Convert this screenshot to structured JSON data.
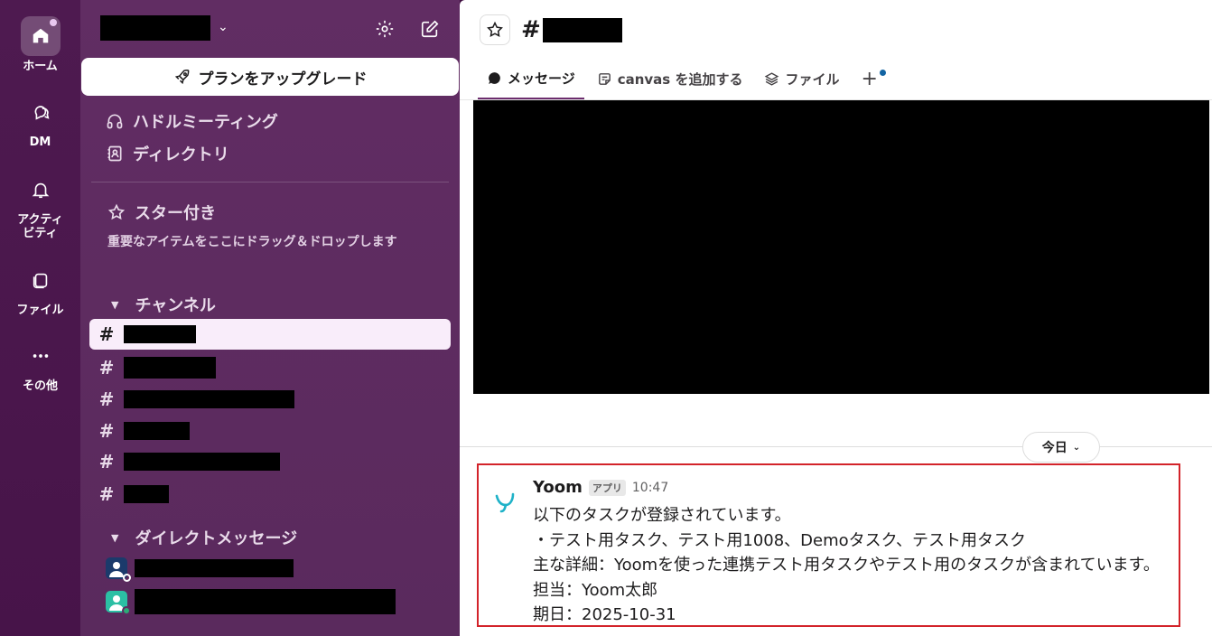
{
  "rail": {
    "items": [
      {
        "label": "ホーム",
        "icon": "home-icon"
      },
      {
        "label": "DM",
        "icon": "dm-icon"
      },
      {
        "label": "アクティ\nビティ",
        "icon": "bell-icon"
      },
      {
        "label": "ファイル",
        "icon": "files-icon"
      },
      {
        "label": "その他",
        "icon": "more-icon"
      }
    ]
  },
  "sidebar": {
    "upgrade_label": "プランをアップグレード",
    "huddle_label": "ハドルミーティング",
    "directory_label": "ディレクトリ",
    "starred_label": "スター付き",
    "starred_hint": "重要なアイテムをここにドラッグ＆ドロップします",
    "channels_label": "チャンネル",
    "dm_label": "ダイレクトメッセージ"
  },
  "channel": {
    "hash": "#",
    "tabs": [
      {
        "label": "メッセージ",
        "icon": "message-icon"
      },
      {
        "label": "canvas を追加する",
        "icon": "canvas-icon"
      },
      {
        "label": "ファイル",
        "icon": "layers-icon"
      }
    ],
    "add_tab": "+"
  },
  "date_pill": "今日",
  "message": {
    "author": "Yoom",
    "badge": "アプリ",
    "time": "10:47",
    "lines": [
      "以下のタスクが登録されています。",
      "・テスト用タスク、テスト用1008、Demoタスク、テスト用タスク",
      "主な詳細：Yoomを使った連携テスト用タスクやテスト用のタスクが含まれています。",
      "担当：Yoom太郎",
      "期日：2025-10-31"
    ]
  },
  "colors": {
    "rail": "#4a154b",
    "sidebar": "#5e2b61",
    "highlight_border": "#d3232a",
    "yoom_logo": "#1fb2c8"
  }
}
